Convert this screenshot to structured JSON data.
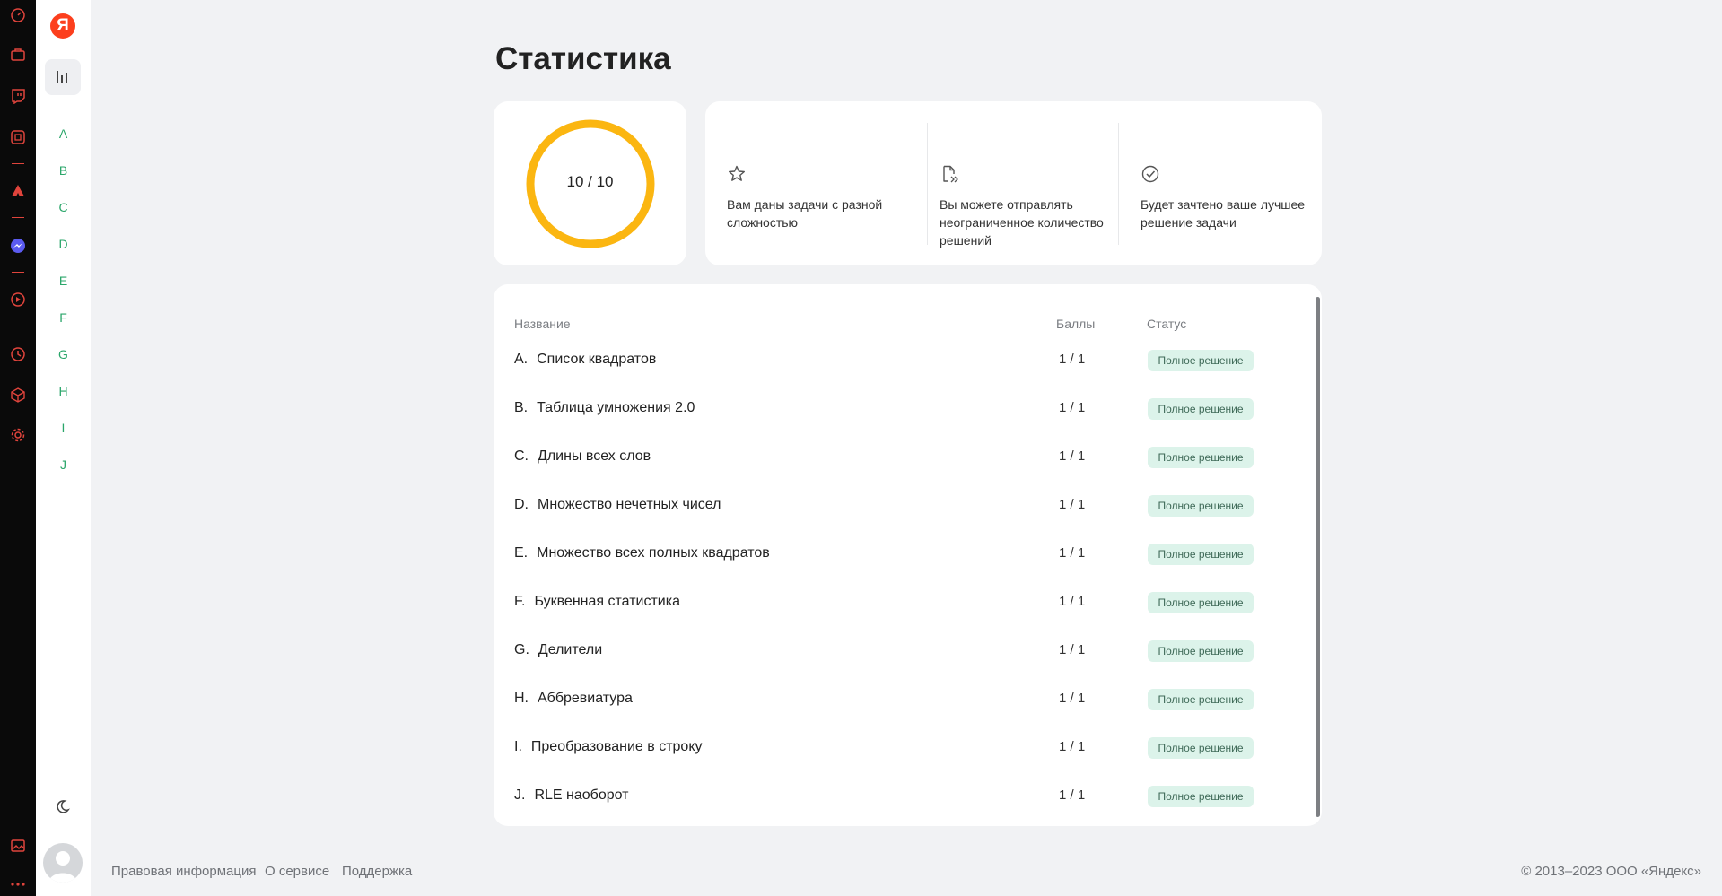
{
  "page": {
    "title": "Статистика"
  },
  "sidebar": {
    "logo": "Я",
    "letters": [
      "A",
      "B",
      "C",
      "D",
      "E",
      "F",
      "G",
      "H",
      "I",
      "J"
    ]
  },
  "summary": {
    "score_text": "10 / 10",
    "score_progress": 1.0,
    "ring_color": "#fbb611",
    "info": [
      {
        "icon": "star-icon",
        "text": "Вам даны задачи с разной сложностью"
      },
      {
        "icon": "document-send-icon",
        "text": "Вы можете отправлять неограниченное количество решений"
      },
      {
        "icon": "check-circle-icon",
        "text": "Будет зачтено ваше лучшее решение задачи"
      }
    ]
  },
  "table": {
    "headers": {
      "name": "Название",
      "score": "Баллы",
      "status": "Статус"
    },
    "rows": [
      {
        "letter": "A.",
        "name": "Список квадратов",
        "score": "1 / 1",
        "status": "Полное решение"
      },
      {
        "letter": "B.",
        "name": "Таблица умножения 2.0",
        "score": "1 / 1",
        "status": "Полное решение"
      },
      {
        "letter": "C.",
        "name": "Длины всех слов",
        "score": "1 / 1",
        "status": "Полное решение"
      },
      {
        "letter": "D.",
        "name": "Множество нечетных чисел",
        "score": "1 / 1",
        "status": "Полное решение"
      },
      {
        "letter": "E.",
        "name": "Множество всех полных квадратов",
        "score": "1 / 1",
        "status": "Полное решение"
      },
      {
        "letter": "F.",
        "name": "Буквенная статистика",
        "score": "1 / 1",
        "status": "Полное решение"
      },
      {
        "letter": "G.",
        "name": "Делители",
        "score": "1 / 1",
        "status": "Полное решение"
      },
      {
        "letter": "H.",
        "name": "Аббревиатура",
        "score": "1 / 1",
        "status": "Полное решение"
      },
      {
        "letter": "I.",
        "name": "Преобразование в строку",
        "score": "1 / 1",
        "status": "Полное решение"
      },
      {
        "letter": "J.",
        "name": "RLE наоборот",
        "score": "1 / 1",
        "status": "Полное решение"
      }
    ]
  },
  "footer": {
    "links": [
      "Правовая информация",
      "О сервисе",
      "Поддержка"
    ],
    "copyright": "© 2013–2023 ООО «Яндекс»"
  },
  "browser_sidebar": {
    "icons": [
      "speedometer-icon",
      "briefcase-icon",
      "twitch-icon",
      "app-icon",
      "aliexpress-icon",
      "messenger-icon",
      "play-icon",
      "clock-icon",
      "cube-icon",
      "gear-icon",
      "gallery-icon",
      "more-icon"
    ]
  }
}
